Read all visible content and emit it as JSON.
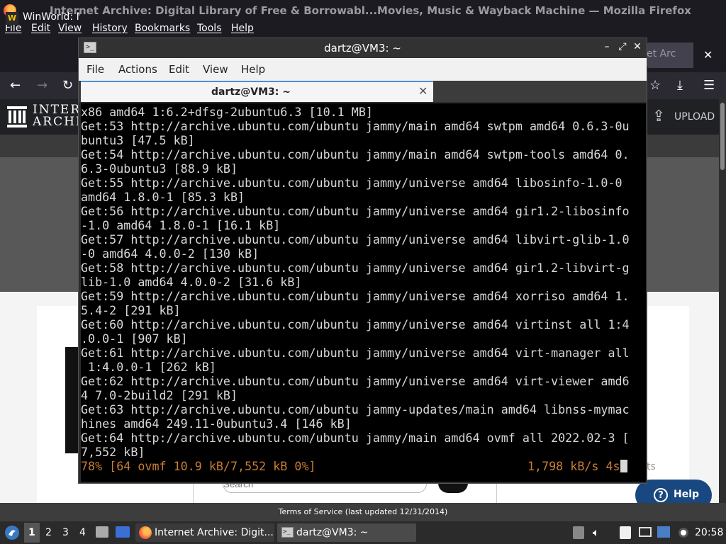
{
  "firefox": {
    "window_title": "Internet Archive: Digital Library of Free & Borrowabl...Movies, Music & Wayback Machine — Mozilla Firefox",
    "menu": [
      "File",
      "Edit",
      "View",
      "History",
      "Bookmarks",
      "Tools",
      "Help"
    ],
    "tabs": [
      {
        "label": "WinWorld: M"
      },
      {
        "label": "et Arc"
      }
    ],
    "site": {
      "logo_text_1": "INTERNET",
      "logo_text_2": "ARCHIVE",
      "upload_label": "UPLOAD",
      "search_placeholder": "Search",
      "partial_text": "ts",
      "help_label": "Help"
    },
    "status_text": "Terms of Service (last updated 12/31/2014)"
  },
  "terminal": {
    "window_title": "dartz@VM3: ~",
    "menu": [
      "File",
      "Actions",
      "Edit",
      "View",
      "Help"
    ],
    "tab_label": "dartz@VM3: ~",
    "lines": [
      "x86 amd64 1:6.2+dfsg-2ubuntu6.3 [10.1 MB]",
      "Get:53 http://archive.ubuntu.com/ubuntu jammy/main amd64 swtpm amd64 0.6.3-0u",
      "buntu3 [47.5 kB]",
      "Get:54 http://archive.ubuntu.com/ubuntu jammy/main amd64 swtpm-tools amd64 0.",
      "6.3-0ubuntu3 [88.9 kB]",
      "Get:55 http://archive.ubuntu.com/ubuntu jammy/universe amd64 libosinfo-1.0-0",
      "amd64 1.8.0-1 [85.3 kB]",
      "Get:56 http://archive.ubuntu.com/ubuntu jammy/universe amd64 gir1.2-libosinfo",
      "-1.0 amd64 1.8.0-1 [16.1 kB]",
      "Get:57 http://archive.ubuntu.com/ubuntu jammy/universe amd64 libvirt-glib-1.0",
      "-0 amd64 4.0.0-2 [130 kB]",
      "Get:58 http://archive.ubuntu.com/ubuntu jammy/universe amd64 gir1.2-libvirt-g",
      "lib-1.0 amd64 4.0.0-2 [31.6 kB]",
      "Get:59 http://archive.ubuntu.com/ubuntu jammy/universe amd64 xorriso amd64 1.",
      "5.4-2 [291 kB]",
      "Get:60 http://archive.ubuntu.com/ubuntu jammy/universe amd64 virtinst all 1:4",
      ".0.0-1 [907 kB]",
      "Get:61 http://archive.ubuntu.com/ubuntu jammy/universe amd64 virt-manager all",
      " 1:4.0.0-1 [262 kB]",
      "Get:62 http://archive.ubuntu.com/ubuntu jammy/universe amd64 virt-viewer amd6",
      "4 7.0-2build2 [291 kB]",
      "Get:63 http://archive.ubuntu.com/ubuntu jammy-updates/main amd64 libnss-mymac",
      "hines amd64 249.11-0ubuntu3.4 [146 kB]",
      "Get:64 http://archive.ubuntu.com/ubuntu jammy/main amd64 ovmf all 2022.02-3 [",
      "7,552 kB]"
    ],
    "progress_left": "78% [64 ovmf 10.9 kB/7,552 kB 0%]",
    "progress_right": "1,798 kB/s 4s"
  },
  "taskbar": {
    "workspaces": [
      "1",
      "2",
      "3",
      "4"
    ],
    "tasks": [
      {
        "label": "Internet Archive: Digit..."
      },
      {
        "label": "dartz@VM3: ~"
      }
    ],
    "clock": "20:58"
  },
  "colors": {
    "terminal_text": "#d8d8d8",
    "terminal_progress": "#c87c32",
    "help_button": "#194880",
    "firefox_chrome": "#1c1b22"
  }
}
